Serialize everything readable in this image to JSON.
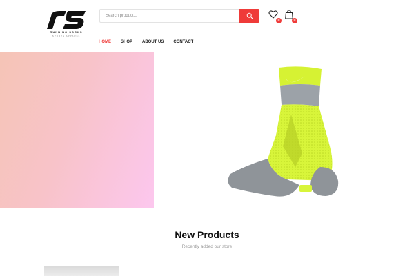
{
  "brand": {
    "tagline": "RUNNING SOCKS",
    "subtagline": "SPORTS APPAREL"
  },
  "search": {
    "placeholder": "Search product..."
  },
  "header_icons": [
    {
      "icon": "heart-icon",
      "count": "0"
    },
    {
      "icon": "shopping-bag-icon",
      "count": "0"
    }
  ],
  "nav": [
    {
      "label": "HOME",
      "active": true
    },
    {
      "label": "SHOP",
      "active": false
    },
    {
      "label": "ABOUT US",
      "active": false
    },
    {
      "label": "CONTACT",
      "active": false
    }
  ],
  "section": {
    "title": "New Products",
    "subtitle": "Recently added our store"
  },
  "colors": {
    "accent": "#ef3b39",
    "hero_gradient_start": "#f5c4b6",
    "hero_gradient_end": "#fcc7ee",
    "sock_neon": "#d8f53a",
    "sock_gray": "#8f9499"
  }
}
